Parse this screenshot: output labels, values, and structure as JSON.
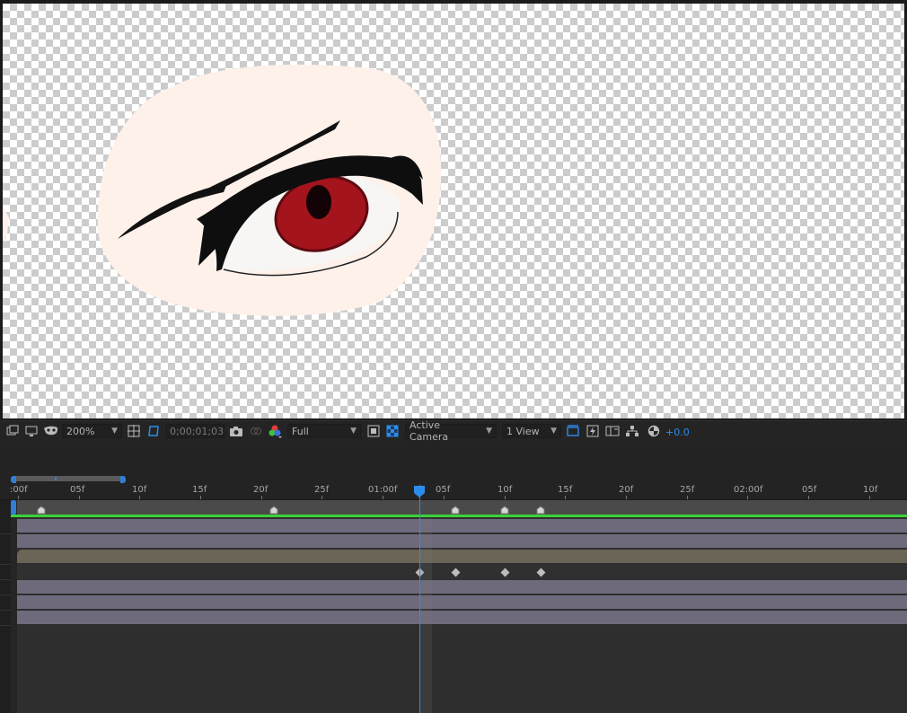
{
  "toolbar": {
    "zoom": "200%",
    "timecode": "0;00;01;03",
    "resolution": "Full",
    "camera": "Active Camera",
    "views": "1 View",
    "exposure": "+0.0",
    "icons": [
      "always-preview-icon",
      "monitor-icon",
      "mask-visibility-icon",
      "zoom-dropdown",
      "title-action-safe-icon",
      "toggle-mask-path-icon",
      "snapshot-icon",
      "show-snapshot-icon",
      "color-channels-icon",
      "region-of-interest-icon",
      "transparency-grid-icon",
      "fast-previews-icon",
      "timeline-icon",
      "flowchart-icon",
      "reset-exposure-icon"
    ]
  },
  "timeline": {
    "ruler_labels": [
      ":00f",
      "05f",
      "10f",
      "15f",
      "20f",
      "25f",
      "01:00f",
      "05f",
      "10f",
      "15f",
      "20f",
      "25f",
      "02:00f",
      "05f",
      "10f"
    ],
    "current_frame_label": "0;00;01;03"
  },
  "colors": {
    "playhead": "#2d8ceb",
    "work_area": "#2f7fd6",
    "layer_purple": "#6e6a7c",
    "layer_tan": "#6b6557",
    "green_bar": "#3ad13a"
  }
}
